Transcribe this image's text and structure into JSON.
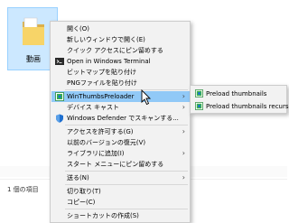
{
  "explorer": {
    "folder_label": "動画",
    "status_text": "1 個の項目"
  },
  "context_menu": {
    "items": [
      {
        "label": "開く(O)",
        "icon": "",
        "submenu": false
      },
      {
        "label": "新しいウィンドウで開く(E)",
        "icon": "",
        "submenu": false
      },
      {
        "label": "クイック アクセスにピン留めする",
        "icon": "",
        "submenu": false
      },
      {
        "label": "Open in Windows Terminal",
        "icon": "terminal-icon",
        "submenu": false
      },
      {
        "label": "ビットマップを貼り付け",
        "icon": "",
        "submenu": false
      },
      {
        "label": "PNGファイルを貼り付け",
        "icon": "",
        "submenu": false
      },
      {
        "label": "WinThumbsPreloader",
        "icon": "winthumbs-icon",
        "submenu": true
      },
      {
        "label": "デバイス キャスト",
        "icon": "",
        "submenu": true
      },
      {
        "label": "Windows Defender でスキャンする...",
        "icon": "defender-shield-icon",
        "submenu": false
      },
      {
        "label": "アクセスを許可する(G)",
        "icon": "",
        "submenu": true
      },
      {
        "label": "以前のバージョンの復元(V)",
        "icon": "",
        "submenu": false
      },
      {
        "label": "ライブラリに追加(I)",
        "icon": "",
        "submenu": true
      },
      {
        "label": "スタート メニューにピン留めする",
        "icon": "",
        "submenu": false
      },
      {
        "label": "送る(N)",
        "icon": "",
        "submenu": true
      },
      {
        "label": "切り取り(T)",
        "icon": "",
        "submenu": false
      },
      {
        "label": "コピー(C)",
        "icon": "",
        "submenu": false
      },
      {
        "label": "ショートカットの作成(S)",
        "icon": "",
        "submenu": false
      }
    ]
  },
  "submenu": {
    "items": [
      {
        "label": "Preload thumbnails",
        "icon": "winthumbs-icon"
      },
      {
        "label": "Preload thumbnails recursively",
        "icon": "winthumbs-icon"
      }
    ]
  },
  "colors": {
    "menu_bg": "#f2f2f2",
    "highlight": "#91c9f7",
    "folder_yellow": "#f7d468",
    "selection_bg": "#cce8ff"
  }
}
